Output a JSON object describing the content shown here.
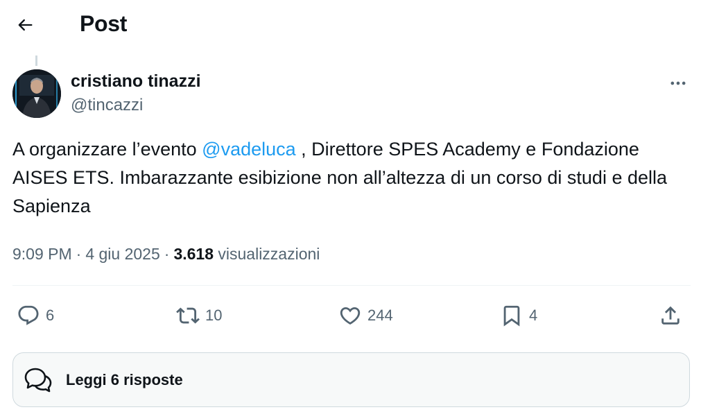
{
  "header": {
    "title": "Post",
    "back_icon": "arrow-left-icon"
  },
  "author": {
    "display_name": "cristiano tinazzi",
    "handle": "@tincazzi",
    "avatar_icon": "avatar-photo"
  },
  "post": {
    "text_before": "A organizzare l’evento ",
    "mention": "@vadeluca",
    "text_after": " , Direttore SPES Academy e Fondazione AISES ETS. Imbarazzante esibizione non all’altezza di un corso di studi e della Sapienza"
  },
  "meta": {
    "time": "9:09 PM",
    "date": "4 giu 2025",
    "separator": "·",
    "views_count": "3.618",
    "views_label": "visualizzazioni"
  },
  "actions": {
    "replies": "6",
    "reposts": "10",
    "likes": "244",
    "bookmarks": "4"
  },
  "replies_button": {
    "label": "Leggi 6 risposte"
  },
  "colors": {
    "text": "#0f1419",
    "secondary": "#536471",
    "accent": "#1d9bf0",
    "border": "#cfd9de"
  }
}
